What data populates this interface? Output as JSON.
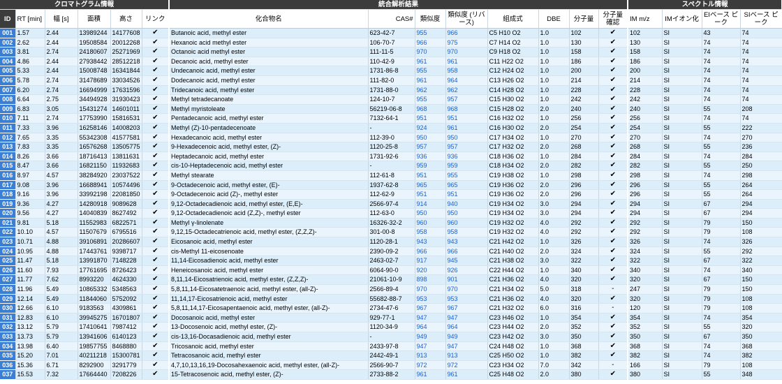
{
  "sections": {
    "chrom": "クロマトグラム情報",
    "integrated": "統合解析結果",
    "spectrum": "スペクトル情報"
  },
  "headers": {
    "id": "ID",
    "rt": "RT [min]",
    "width": "幅 [s]",
    "area": "面積",
    "height": "高さ",
    "link": "リンク",
    "compound": "化合物名",
    "cas": "CAS#",
    "similarity": "類似度",
    "reverse_similarity": "類似度 (リバース)",
    "formula": "組成式",
    "dbe": "DBE",
    "mw": "分子量",
    "mw_confirm": "分子量 確認",
    "im_mz": "IM m/z",
    "im_ion": "IMイオン化",
    "ei_base": "EIベース ピーク",
    "si_base": "SIベース ピーク"
  },
  "rows": [
    {
      "id": "001",
      "rt": "1.57",
      "width": "2.44",
      "area": "13989244",
      "height": "14177608",
      "link": "✔",
      "compound": "Butanoic acid, methyl ester",
      "cas": "623-42-7",
      "sim": "955",
      "rsim": "966",
      "formula": "C5 H10 O2",
      "dbe": "1.0",
      "mw": "102",
      "conf": "✔",
      "im": "102",
      "ion": "SI",
      "ei": "43",
      "si": "74"
    },
    {
      "id": "002",
      "rt": "2.62",
      "width": "2.44",
      "area": "19508584",
      "height": "20012268",
      "link": "✔",
      "compound": "Hexanoic acid methyl ester",
      "cas": "106-70-7",
      "sim": "966",
      "rsim": "975",
      "formula": "C7 H14 O2",
      "dbe": "1.0",
      "mw": "130",
      "conf": "✔",
      "im": "130",
      "ion": "SI",
      "ei": "74",
      "si": "74"
    },
    {
      "id": "003",
      "rt": "3.81",
      "width": "2.74",
      "area": "24180607",
      "height": "25271969",
      "link": "✔",
      "compound": "Octanoic acid methyl ester",
      "cas": "111-11-5",
      "sim": "970",
      "rsim": "970",
      "formula": "C9 H18 O2",
      "dbe": "1.0",
      "mw": "158",
      "conf": "✔",
      "im": "158",
      "ion": "SI",
      "ei": "74",
      "si": "74"
    },
    {
      "id": "004",
      "rt": "4.86",
      "width": "2.44",
      "area": "27938442",
      "height": "28512218",
      "link": "✔",
      "compound": "Decanoic acid, methyl ester",
      "cas": "110-42-9",
      "sim": "961",
      "rsim": "961",
      "formula": "C11 H22 O2",
      "dbe": "1.0",
      "mw": "186",
      "conf": "✔",
      "im": "186",
      "ion": "SI",
      "ei": "74",
      "si": "74"
    },
    {
      "id": "005",
      "rt": "5.33",
      "width": "2.44",
      "area": "15008748",
      "height": "16341844",
      "link": "✔",
      "compound": "Undecanoic acid, methyl ester",
      "cas": "1731-86-8",
      "sim": "955",
      "rsim": "958",
      "formula": "C12 H24 O2",
      "dbe": "1.0",
      "mw": "200",
      "conf": "✔",
      "im": "200",
      "ion": "SI",
      "ei": "74",
      "si": "74"
    },
    {
      "id": "006",
      "rt": "5.78",
      "width": "2.74",
      "area": "31478689",
      "height": "33034526",
      "link": "✔",
      "compound": "Dodecanoic acid, methyl ester",
      "cas": "111-82-0",
      "sim": "961",
      "rsim": "964",
      "formula": "C13 H26 O2",
      "dbe": "1.0",
      "mw": "214",
      "conf": "✔",
      "im": "214",
      "ion": "SI",
      "ei": "74",
      "si": "74"
    },
    {
      "id": "007",
      "rt": "6.20",
      "width": "2.74",
      "area": "16694999",
      "height": "17631596",
      "link": "✔",
      "compound": "Tridecanoic acid, methyl ester",
      "cas": "1731-88-0",
      "sim": "962",
      "rsim": "962",
      "formula": "C14 H28 O2",
      "dbe": "1.0",
      "mw": "228",
      "conf": "✔",
      "im": "228",
      "ion": "SI",
      "ei": "74",
      "si": "74"
    },
    {
      "id": "008",
      "rt": "6.64",
      "width": "2.75",
      "area": "34494928",
      "height": "31930423",
      "link": "✔",
      "compound": "Methyl tetradecanoate",
      "cas": "124-10-7",
      "sim": "955",
      "rsim": "957",
      "formula": "C15 H30 O2",
      "dbe": "1.0",
      "mw": "242",
      "conf": "✔",
      "im": "242",
      "ion": "SI",
      "ei": "74",
      "si": "74"
    },
    {
      "id": "009",
      "rt": "6.83",
      "width": "3.05",
      "area": "15431274",
      "height": "14601011",
      "link": "✔",
      "compound": "Methyl myristoleate",
      "cas": "56219-06-8",
      "sim": "968",
      "rsim": "968",
      "formula": "C15 H28 O2",
      "dbe": "2.0",
      "mw": "240",
      "conf": "✔",
      "im": "240",
      "ion": "SI",
      "ei": "55",
      "si": "208"
    },
    {
      "id": "010",
      "rt": "7.11",
      "width": "2.74",
      "area": "17753990",
      "height": "15816531",
      "link": "✔",
      "compound": "Pentadecanoic acid, methyl ester",
      "cas": "7132-64-1",
      "sim": "951",
      "rsim": "951",
      "formula": "C16 H32 O2",
      "dbe": "1.0",
      "mw": "256",
      "conf": "✔",
      "im": "256",
      "ion": "SI",
      "ei": "74",
      "si": "74"
    },
    {
      "id": "011",
      "rt": "7.33",
      "width": "3.96",
      "area": "16258146",
      "height": "14008203",
      "link": "✔",
      "compound": "Methyl (Z)-10-pentadecenoate",
      "cas": "-",
      "sim": "924",
      "rsim": "961",
      "formula": "C16 H30 O2",
      "dbe": "2.0",
      "mw": "254",
      "conf": "✔",
      "im": "254",
      "ion": "SI",
      "ei": "55",
      "si": "222"
    },
    {
      "id": "012",
      "rt": "7.65",
      "width": "3.35",
      "area": "55342308",
      "height": "41577581",
      "link": "✔",
      "compound": "Hexadecanoic acid, methyl ester",
      "cas": "112-39-0",
      "sim": "950",
      "rsim": "950",
      "formula": "C17 H34 O2",
      "dbe": "1.0",
      "mw": "270",
      "conf": "✔",
      "im": "270",
      "ion": "SI",
      "ei": "74",
      "si": "270"
    },
    {
      "id": "013",
      "rt": "7.83",
      "width": "3.35",
      "area": "16576268",
      "height": "13505775",
      "link": "✔",
      "compound": "9-Hexadecenoic acid, methyl ester, (Z)-",
      "cas": "1120-25-8",
      "sim": "957",
      "rsim": "957",
      "formula": "C17 H32 O2",
      "dbe": "2.0",
      "mw": "268",
      "conf": "✔",
      "im": "268",
      "ion": "SI",
      "ei": "55",
      "si": "236"
    },
    {
      "id": "014",
      "rt": "8.26",
      "width": "3.66",
      "area": "18716413",
      "height": "13811631",
      "link": "✔",
      "compound": "Heptadecanoic acid, methyl ester",
      "cas": "1731-92-6",
      "sim": "936",
      "rsim": "936",
      "formula": "C18 H36 O2",
      "dbe": "1.0",
      "mw": "284",
      "conf": "✔",
      "im": "284",
      "ion": "SI",
      "ei": "74",
      "si": "284"
    },
    {
      "id": "015",
      "rt": "8.47",
      "width": "3.66",
      "area": "16821150",
      "height": "11932683",
      "link": "✔",
      "compound": "cis-10-Heptadecenoic acid, methyl ester",
      "cas": "-",
      "sim": "959",
      "rsim": "959",
      "formula": "C18 H34 O2",
      "dbe": "2.0",
      "mw": "282",
      "conf": "✔",
      "im": "282",
      "ion": "SI",
      "ei": "55",
      "si": "250"
    },
    {
      "id": "016",
      "rt": "8.97",
      "width": "4.57",
      "area": "38284920",
      "height": "23037522",
      "link": "✔",
      "compound": "Methyl stearate",
      "cas": "112-61-8",
      "sim": "951",
      "rsim": "955",
      "formula": "C19 H38 O2",
      "dbe": "1.0",
      "mw": "298",
      "conf": "✔",
      "im": "298",
      "ion": "SI",
      "ei": "74",
      "si": "298"
    },
    {
      "id": "017",
      "rt": "9.08",
      "width": "3.96",
      "area": "16688941",
      "height": "10574496",
      "link": "✔",
      "compound": "9-Octadecenoic acid, methyl ester, (E)-",
      "cas": "1937-62-8",
      "sim": "965",
      "rsim": "965",
      "formula": "C19 H36 O2",
      "dbe": "2.0",
      "mw": "296",
      "conf": "✔",
      "im": "296",
      "ion": "SI",
      "ei": "55",
      "si": "264"
    },
    {
      "id": "018",
      "rt": "9.16",
      "width": "3.96",
      "area": "33992198",
      "height": "22081850",
      "link": "✔",
      "compound": "9-Octadecenoic acid (Z)-, methyl ester",
      "cas": "112-62-9",
      "sim": "951",
      "rsim": "951",
      "formula": "C19 H36 O2",
      "dbe": "2.0",
      "mw": "296",
      "conf": "✔",
      "im": "296",
      "ion": "SI",
      "ei": "55",
      "si": "264"
    },
    {
      "id": "019",
      "rt": "9.36",
      "width": "4.27",
      "area": "14280918",
      "height": "9089628",
      "link": "✔",
      "compound": "9,12-Octadecadienoic acid, methyl ester, (E,E)-",
      "cas": "2566-97-4",
      "sim": "914",
      "rsim": "940",
      "formula": "C19 H34 O2",
      "dbe": "3.0",
      "mw": "294",
      "conf": "✔",
      "im": "294",
      "ion": "SI",
      "ei": "67",
      "si": "294"
    },
    {
      "id": "020",
      "rt": "9.56",
      "width": "4.27",
      "area": "14040839",
      "height": "8627492",
      "link": "✔",
      "compound": "9,12-Octadecadienoic acid (Z,Z)-, methyl ester",
      "cas": "112-63-0",
      "sim": "950",
      "rsim": "950",
      "formula": "C19 H34 O2",
      "dbe": "3.0",
      "mw": "294",
      "conf": "✔",
      "im": "294",
      "ion": "SI",
      "ei": "67",
      "si": "294"
    },
    {
      "id": "021",
      "rt": "9.81",
      "width": "5.18",
      "area": "11552983",
      "height": "6822571",
      "link": "✔",
      "compound": "Methyl γ-linolenate",
      "cas": "16326-32-2",
      "sim": "960",
      "rsim": "960",
      "formula": "C19 H32 O2",
      "dbe": "4.0",
      "mw": "292",
      "conf": "✔",
      "im": "292",
      "ion": "SI",
      "ei": "79",
      "si": "150"
    },
    {
      "id": "022",
      "rt": "10.10",
      "width": "4.57",
      "area": "11507679",
      "height": "6795516",
      "link": "✔",
      "compound": "9,12,15-Octadecatrienoic acid, methyl ester, (Z,Z,Z)-",
      "cas": "301-00-8",
      "sim": "958",
      "rsim": "958",
      "formula": "C19 H32 O2",
      "dbe": "4.0",
      "mw": "292",
      "conf": "✔",
      "im": "292",
      "ion": "SI",
      "ei": "79",
      "si": "108"
    },
    {
      "id": "023",
      "rt": "10.71",
      "width": "4.88",
      "area": "39106891",
      "height": "20286607",
      "link": "✔",
      "compound": "Eicosanoic acid, methyl ester",
      "cas": "1120-28-1",
      "sim": "943",
      "rsim": "943",
      "formula": "C21 H42 O2",
      "dbe": "1.0",
      "mw": "326",
      "conf": "✔",
      "im": "326",
      "ion": "SI",
      "ei": "74",
      "si": "326"
    },
    {
      "id": "024",
      "rt": "10.95",
      "width": "4.88",
      "area": "17443761",
      "height": "9398717",
      "link": "✔",
      "compound": "cis-Methyl 11-eicosenoate",
      "cas": "2390-09-2",
      "sim": "966",
      "rsim": "966",
      "formula": "C21 H40 O2",
      "dbe": "2.0",
      "mw": "324",
      "conf": "✔",
      "im": "324",
      "ion": "SI",
      "ei": "55",
      "si": "292"
    },
    {
      "id": "025",
      "rt": "11.47",
      "width": "5.18",
      "area": "13991870",
      "height": "7148228",
      "link": "✔",
      "compound": "11,14-Eicosadienoic acid, methyl ester",
      "cas": "2463-02-7",
      "sim": "917",
      "rsim": "945",
      "formula": "C21 H38 O2",
      "dbe": "3.0",
      "mw": "322",
      "conf": "✔",
      "im": "322",
      "ion": "SI",
      "ei": "67",
      "si": "322"
    },
    {
      "id": "026",
      "rt": "11.60",
      "width": "7.93",
      "area": "17761695",
      "height": "8726423",
      "link": "✔",
      "compound": "Heneicosanoic acid, methyl ester",
      "cas": "6064-90-0",
      "sim": "920",
      "rsim": "926",
      "formula": "C22 H44 O2",
      "dbe": "1.0",
      "mw": "340",
      "conf": "✔",
      "im": "340",
      "ion": "SI",
      "ei": "74",
      "si": "340"
    },
    {
      "id": "027",
      "rt": "11.77",
      "width": "7.62",
      "area": "8993220",
      "height": "4624330",
      "link": "✔",
      "compound": "8,11,14-Eicosatrienoic acid, methyl ester, (Z,Z,Z)-",
      "cas": "21061-10-9",
      "sim": "898",
      "rsim": "901",
      "formula": "C21 H36 O2",
      "dbe": "4.0",
      "mw": "320",
      "conf": "✔",
      "im": "320",
      "ion": "SI",
      "ei": "67",
      "si": "150"
    },
    {
      "id": "028",
      "rt": "11.96",
      "width": "5.49",
      "area": "10865332",
      "height": "5348563",
      "link": "✔",
      "compound": "5,8,11,14-Eicosatetraenoic acid, methyl ester, (all-Z)-",
      "cas": "2566-89-4",
      "sim": "970",
      "rsim": "970",
      "formula": "C21 H34 O2",
      "dbe": "5.0",
      "mw": "318",
      "conf": "-",
      "im": "247",
      "ion": "SI",
      "ei": "79",
      "si": "150"
    },
    {
      "id": "029",
      "rt": "12.14",
      "width": "5.49",
      "area": "11844060",
      "height": "5752092",
      "link": "✔",
      "compound": "11,14,17-Eicosatrienoic acid, methyl ester",
      "cas": "55682-88-7",
      "sim": "953",
      "rsim": "953",
      "formula": "C21 H36 O2",
      "dbe": "4.0",
      "mw": "320",
      "conf": "✔",
      "im": "320",
      "ion": "SI",
      "ei": "79",
      "si": "108"
    },
    {
      "id": "030",
      "rt": "12.66",
      "width": "6.10",
      "area": "9183563",
      "height": "4309861",
      "link": "✔",
      "compound": "5,8,11,14,17-Eicosapentaenoic acid, methyl ester, (all-Z)-",
      "cas": "2734-47-6",
      "sim": "967",
      "rsim": "967",
      "formula": "C21 H32 O2",
      "dbe": "6.0",
      "mw": "316",
      "conf": "-",
      "im": "120",
      "ion": "SI",
      "ei": "79",
      "si": "108"
    },
    {
      "id": "031",
      "rt": "12.83",
      "width": "6.10",
      "area": "39945275",
      "height": "16701807",
      "link": "✔",
      "compound": "Docosanoic acid, methyl ester",
      "cas": "929-77-1",
      "sim": "947",
      "rsim": "947",
      "formula": "C23 H46 O2",
      "dbe": "1.0",
      "mw": "354",
      "conf": "✔",
      "im": "354",
      "ion": "SI",
      "ei": "74",
      "si": "354"
    },
    {
      "id": "032",
      "rt": "13.12",
      "width": "5.79",
      "area": "17410641",
      "height": "7987412",
      "link": "✔",
      "compound": "13-Docosenoic acid, methyl ester, (Z)-",
      "cas": "1120-34-9",
      "sim": "964",
      "rsim": "964",
      "formula": "C23 H44 O2",
      "dbe": "2.0",
      "mw": "352",
      "conf": "✔",
      "im": "352",
      "ion": "SI",
      "ei": "55",
      "si": "320"
    },
    {
      "id": "033",
      "rt": "13.73",
      "width": "5.79",
      "area": "13941606",
      "height": "6140123",
      "link": "✔",
      "compound": "cis-13,16-Docasadienoic acid, methyl ester",
      "cas": "-",
      "sim": "949",
      "rsim": "949",
      "formula": "C23 H42 O2",
      "dbe": "3.0",
      "mw": "350",
      "conf": "✔",
      "im": "350",
      "ion": "SI",
      "ei": "67",
      "si": "350"
    },
    {
      "id": "034",
      "rt": "13.98",
      "width": "6.40",
      "area": "19857755",
      "height": "8468880",
      "link": "✔",
      "compound": "Tricosanoic acid, methyl ester",
      "cas": "2433-97-8",
      "sim": "947",
      "rsim": "947",
      "formula": "C24 H48 O2",
      "dbe": "1.0",
      "mw": "368",
      "conf": "✔",
      "im": "368",
      "ion": "SI",
      "ei": "74",
      "si": "368"
    },
    {
      "id": "035",
      "rt": "15.20",
      "width": "7.01",
      "area": "40211218",
      "height": "15300781",
      "link": "✔",
      "compound": "Tetracosanoic acid, methyl ester",
      "cas": "2442-49-1",
      "sim": "913",
      "rsim": "913",
      "formula": "C25 H50 O2",
      "dbe": "1.0",
      "mw": "382",
      "conf": "✔",
      "im": "382",
      "ion": "SI",
      "ei": "74",
      "si": "382"
    },
    {
      "id": "036",
      "rt": "15.36",
      "width": "6.71",
      "area": "8292900",
      "height": "3291779",
      "link": "✔",
      "compound": "4,7,10,13,16,19-Docosahexaenoic acid, methyl ester, (all-Z)-",
      "cas": "2566-90-7",
      "sim": "972",
      "rsim": "972",
      "formula": "C23 H34 O2",
      "dbe": "7.0",
      "mw": "342",
      "conf": "-",
      "im": "166",
      "ion": "SI",
      "ei": "79",
      "si": "108"
    },
    {
      "id": "037",
      "rt": "15.53",
      "width": "7.32",
      "area": "17664440",
      "height": "7208226",
      "link": "✔",
      "compound": "15-Tetracosenoic acid, methyl ester, (Z)-",
      "cas": "2733-88-2",
      "sim": "961",
      "rsim": "961",
      "formula": "C25 H48 O2",
      "dbe": "2.0",
      "mw": "380",
      "conf": "✔",
      "im": "380",
      "ion": "SI",
      "ei": "55",
      "si": "348"
    }
  ]
}
